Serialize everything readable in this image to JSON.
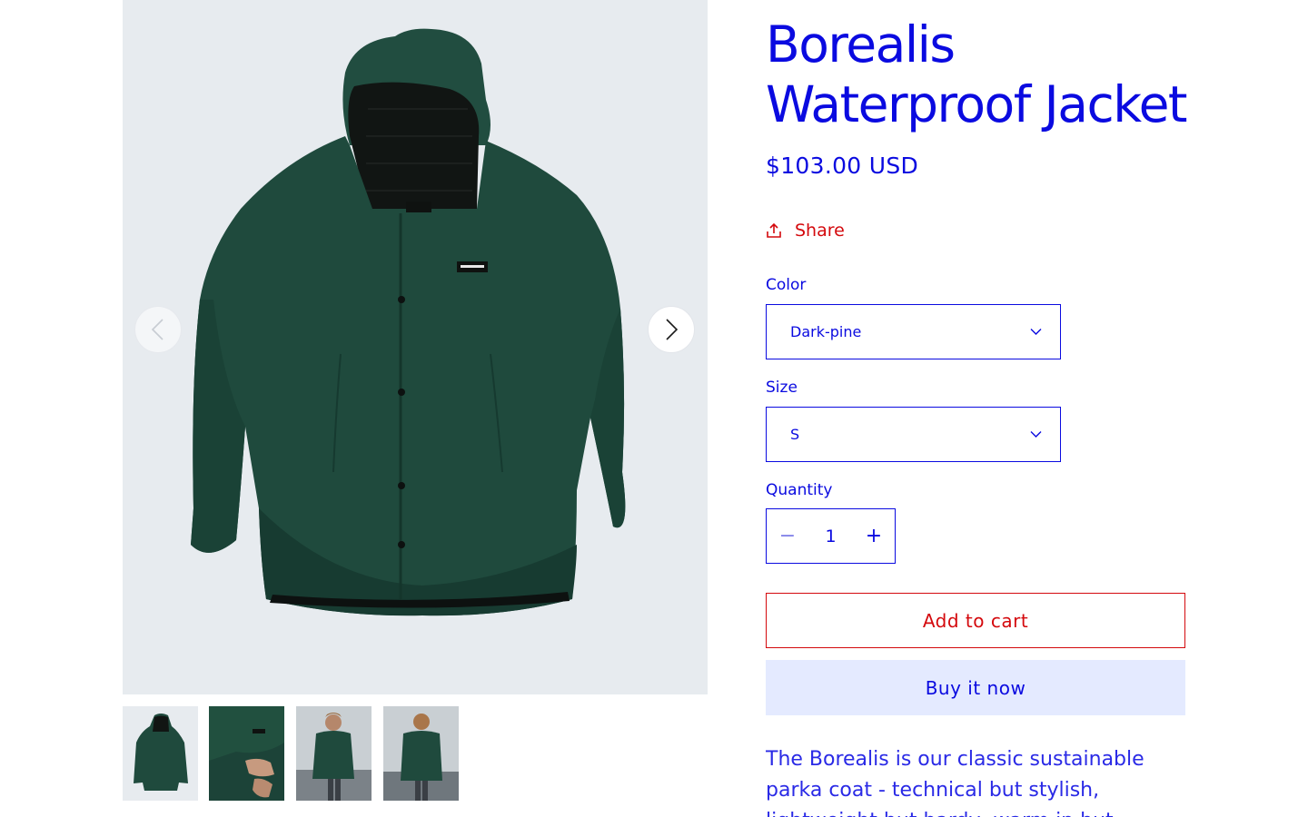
{
  "product": {
    "title": "Borealis Waterproof Jacket",
    "price": "$103.00 USD",
    "share_label": "Share",
    "description": "The Borealis is our classic sustainable parka coat - technical but stylish, lightweight but hardy, warm in but flexible"
  },
  "options": {
    "color": {
      "label": "Color",
      "value": "Dark-pine"
    },
    "size": {
      "label": "Size",
      "value": "S"
    },
    "quantity": {
      "label": "Quantity",
      "value": "1",
      "decrease": "−",
      "increase": "+"
    }
  },
  "actions": {
    "add_to_cart": "Add to cart",
    "buy_now": "Buy it now"
  },
  "gallery": {
    "prev_icon": "chevron-left-icon",
    "next_icon": "chevron-right-icon",
    "thumbnails": [
      {
        "name": "jacket-flat-front"
      },
      {
        "name": "jacket-sleeve-detail"
      },
      {
        "name": "model-front"
      },
      {
        "name": "model-back"
      }
    ]
  },
  "colors": {
    "accent_blue": "#0a0ae0",
    "accent_red": "#d4090d",
    "jacket_green": "#1f4a3d",
    "buy_now_bg": "#e4eaff",
    "gallery_bg": "#e7ebef"
  }
}
